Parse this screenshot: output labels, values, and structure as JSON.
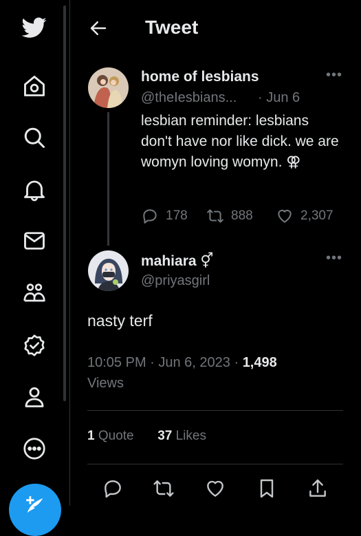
{
  "header": {
    "title": "Tweet"
  },
  "sidebar": {
    "items": [
      "twitter-logo",
      "home",
      "explore",
      "notifications",
      "messages",
      "communities",
      "verified",
      "profile",
      "more"
    ]
  },
  "parent_tweet": {
    "name": "home of lesbians",
    "handle": "@theIesbians...",
    "date": "· Jun 6",
    "text": "lesbian reminder: lesbians don't have nor like dick. we are womyn loving womyn. ⚢",
    "replies": "178",
    "retweets": "888",
    "likes": "2,307"
  },
  "main_tweet": {
    "name": "mahiara",
    "name_symbol": "⚥",
    "handle": "@priyasgirl",
    "text": "nasty terf",
    "time": "10:05 PM · Jun 6, 2023 · ",
    "views_count": "1,498",
    "views_label": "Views",
    "quotes_count": "1",
    "quotes_label": "Quote",
    "likes_count": "37",
    "likes_label": "Likes"
  },
  "colors": {
    "accent": "#1d9bf0",
    "background": "#000000",
    "muted": "#71767b"
  }
}
